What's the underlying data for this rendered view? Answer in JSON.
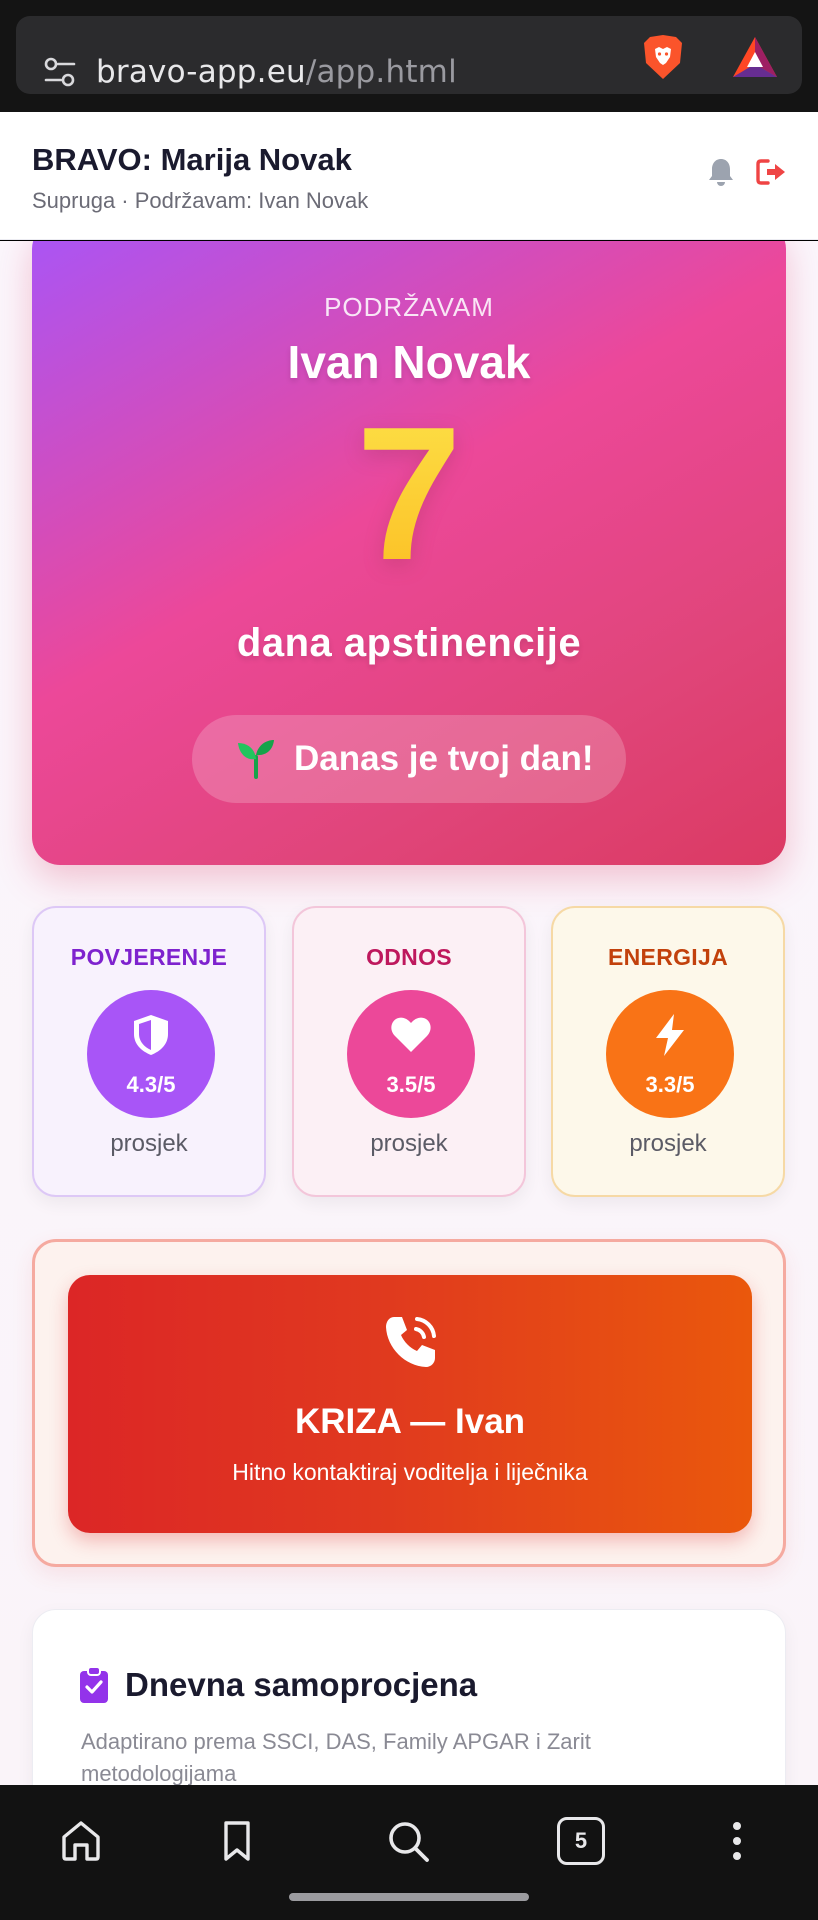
{
  "browser": {
    "url_domain": "bravo-app.eu",
    "url_path": "/app.html",
    "tab_count": "5"
  },
  "header": {
    "title": "BRAVO: Marija Novak",
    "subtitle": "Supruga · Podržavam: Ivan Novak"
  },
  "hero": {
    "label": "PODRŽAVAM",
    "name": "Ivan Novak",
    "days": "7",
    "unit": "dana apstinencije",
    "pill": "Danas je tvoj dan!"
  },
  "metrics": [
    {
      "title": "POVJERENJE",
      "score": "4.3/5",
      "foot": "prosjek",
      "icon": "shield-icon",
      "color": "#a855f7"
    },
    {
      "title": "ODNOS",
      "score": "3.5/5",
      "foot": "prosjek",
      "icon": "heart-icon",
      "color": "#ec4899"
    },
    {
      "title": "ENERGIJA",
      "score": "3.3/5",
      "foot": "prosjek",
      "icon": "bolt-icon",
      "color": "#f97316"
    }
  ],
  "crisis": {
    "title": "KRIZA — Ivan",
    "subtitle": "Hitno kontaktiraj voditelja i liječnika"
  },
  "assessment": {
    "title": "Dnevna samoprocjena",
    "description": "Adaptirano prema SSCI, DAS, Family APGAR i Zarit metodologijama"
  },
  "colors": {
    "accent_purple": "#a855f7",
    "accent_pink": "#ec4899",
    "accent_orange": "#f97316",
    "crisis_red": "#dc2626",
    "streak_yellow": "#facc15"
  }
}
